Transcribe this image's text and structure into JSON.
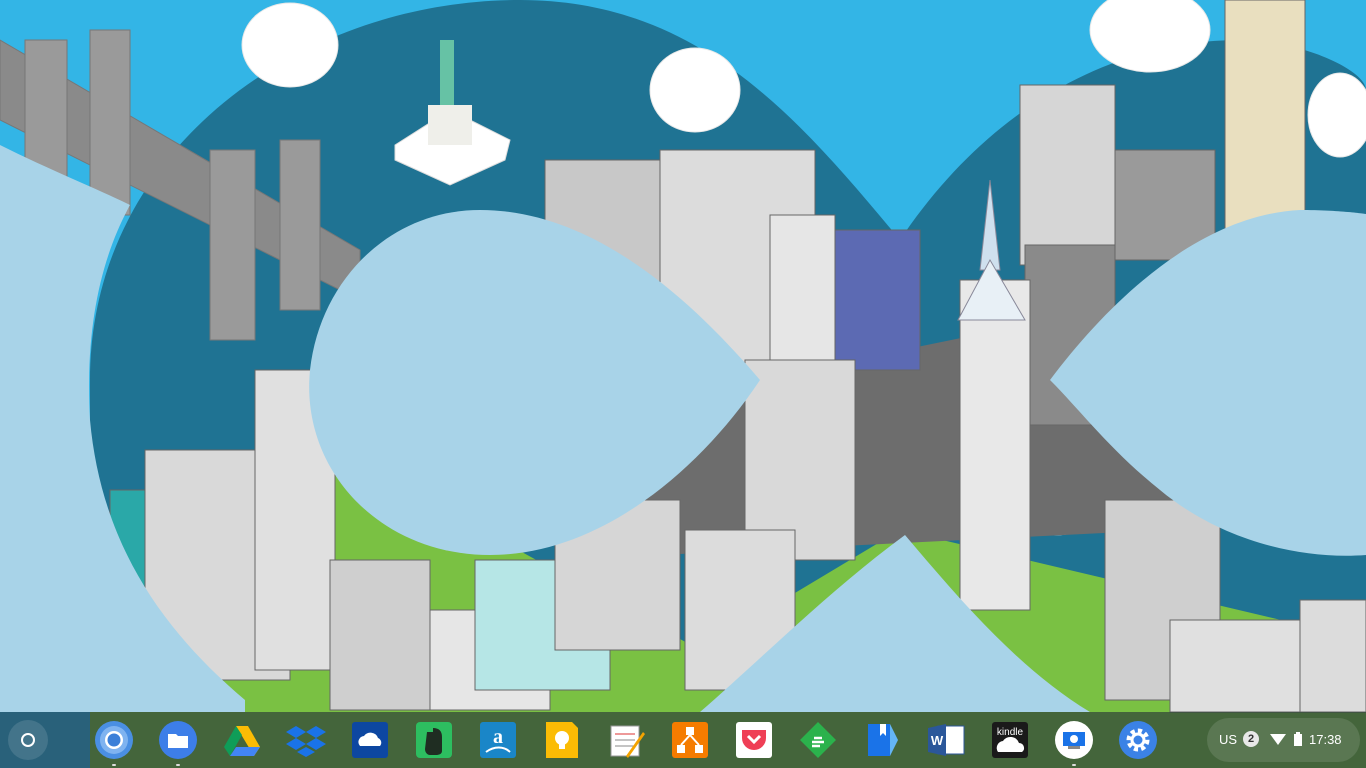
{
  "shelf": {
    "apps": [
      {
        "name": "chrome-app-icon",
        "running": true
      },
      {
        "name": "files-app-icon",
        "running": true
      },
      {
        "name": "google-drive-app-icon",
        "running": false
      },
      {
        "name": "dropbox-app-icon",
        "running": false
      },
      {
        "name": "onedrive-app-icon",
        "running": false
      },
      {
        "name": "evernote-app-icon",
        "running": false
      },
      {
        "name": "amazon-drive-app-icon",
        "running": false
      },
      {
        "name": "google-keep-app-icon",
        "running": false
      },
      {
        "name": "text-editor-app-icon",
        "running": false
      },
      {
        "name": "diagram-app-icon",
        "running": false
      },
      {
        "name": "pocket-app-icon",
        "running": false
      },
      {
        "name": "feedly-app-icon",
        "running": false
      },
      {
        "name": "play-books-app-icon",
        "running": false
      },
      {
        "name": "microsoft-word-app-icon",
        "running": false
      },
      {
        "name": "kindle-app-icon",
        "running": false
      },
      {
        "name": "chrome-remote-desktop-app-icon",
        "running": true
      },
      {
        "name": "settings-app-icon",
        "running": false
      }
    ],
    "kindle_label": "kindle"
  },
  "tray": {
    "input_method": "US",
    "notification_count": "2",
    "time": "17:38"
  },
  "colors": {
    "sky": "#2aa8dd",
    "deep_teal": "#1f7393",
    "pale_blue": "#a8d3e8",
    "shelf": "#2e3a46"
  }
}
